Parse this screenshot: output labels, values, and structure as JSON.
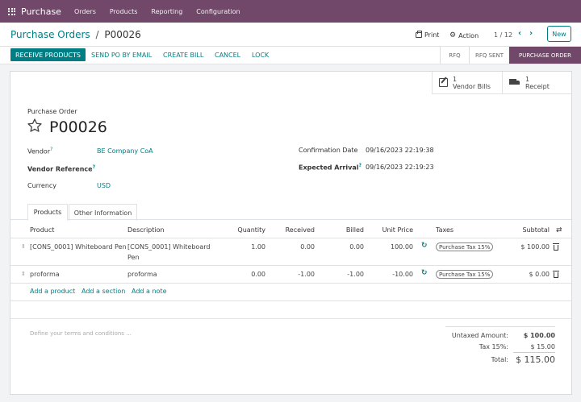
{
  "nav": {
    "app_name": "Purchase",
    "items": [
      "Orders",
      "Products",
      "Reporting",
      "Configuration"
    ]
  },
  "breadcrumb": {
    "parent": "Purchase Orders",
    "separator": "/",
    "current": "P00026"
  },
  "control": {
    "print_label": "Print",
    "action_label": "Action",
    "pager": "1 / 12",
    "new_label": "New"
  },
  "statusbar": {
    "buttons": [
      "RECEIVE PRODUCTS",
      "SEND PO BY EMAIL",
      "CREATE BILL",
      "CANCEL",
      "LOCK"
    ],
    "stages": [
      "RFQ",
      "RFQ SENT",
      "PURCHASE ORDER"
    ],
    "active_stage": "PURCHASE ORDER"
  },
  "smart_buttons": [
    {
      "count": "1",
      "label": "Vendor Bills",
      "icon": "bills-icon"
    },
    {
      "count": "1",
      "label": "Receipt",
      "icon": "truck-icon"
    }
  ],
  "form": {
    "type_label": "Purchase Order",
    "name": "P00026",
    "vendor_label": "Vendor",
    "vendor_value": "BE Company CoA",
    "vendor_ref_label": "Vendor Reference",
    "currency_label": "Currency",
    "currency_value": "USD",
    "confirmation_label": "Confirmation Date",
    "confirmation_value": "09/16/2023 22:19:38",
    "expected_label": "Expected Arrival",
    "expected_value": "09/16/2023 22:19:23",
    "help_marker": "?"
  },
  "tabs": [
    "Products",
    "Other Information"
  ],
  "table": {
    "headers": [
      "Product",
      "Description",
      "Quantity",
      "Received",
      "Billed",
      "Unit Price",
      "Taxes",
      "Subtotal"
    ],
    "rows": [
      {
        "product": "[CONS_0001] Whiteboard Pen",
        "description": "[CONS_0001] Whiteboard Pen",
        "quantity": "1.00",
        "received": "0.00",
        "billed": "0.00",
        "unit_price": "100.00",
        "tax": "Purchase Tax 15%",
        "subtotal": "$ 100.00"
      },
      {
        "product": "proforma",
        "description": "proforma",
        "quantity": "0.00",
        "received": "-1.00",
        "billed": "-1.00",
        "unit_price": "-10.00",
        "tax": "Purchase Tax 15%",
        "subtotal": "$ 0.00"
      }
    ],
    "add_links": [
      "Add a product",
      "Add a section",
      "Add a note"
    ]
  },
  "terms_placeholder": "Define your terms and conditions ...",
  "totals": {
    "untaxed_label": "Untaxed Amount:",
    "untaxed_value": "$ 100.00",
    "tax_label": "Tax 15%:",
    "tax_value": "$ 15.00",
    "total_label": "Total:",
    "total_value": "$ 115.00"
  },
  "colors": {
    "brand": "#71486a",
    "accent": "#017e84"
  }
}
